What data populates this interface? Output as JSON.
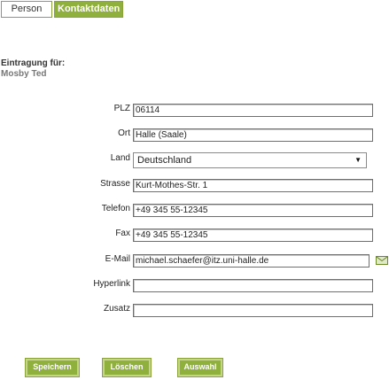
{
  "tabs": {
    "person": "Person",
    "kontakt": "Kontaktdaten"
  },
  "entry": {
    "title": "Eintragung für:",
    "name": "Mosby  Ted"
  },
  "form": {
    "plz": {
      "label": "PLZ",
      "value": "06114"
    },
    "ort": {
      "label": "Ort",
      "value": "Halle (Saale)"
    },
    "land": {
      "label": "Land",
      "value": "Deutschland"
    },
    "strasse": {
      "label": "Strasse",
      "value": "Kurt-Mothes-Str. 1"
    },
    "telefon": {
      "label": "Telefon",
      "value": "+49 345 55-12345"
    },
    "fax": {
      "label": "Fax",
      "value": "+49 345 55-12345"
    },
    "email": {
      "label": "E-Mail",
      "value": "michael.schaefer@itz.uni-halle.de"
    },
    "hyperlink": {
      "label": "Hyperlink",
      "value": ""
    },
    "zusatz": {
      "label": "Zusatz",
      "value": ""
    }
  },
  "icons": {
    "dropdown": "chevron-down-icon",
    "mail": "envelope-icon"
  },
  "buttons": {
    "save": "Speichern",
    "delete": "Löschen",
    "select": "Auswahl"
  },
  "colors": {
    "accent": "#8fb03c",
    "accent_border": "#8aa33a"
  }
}
